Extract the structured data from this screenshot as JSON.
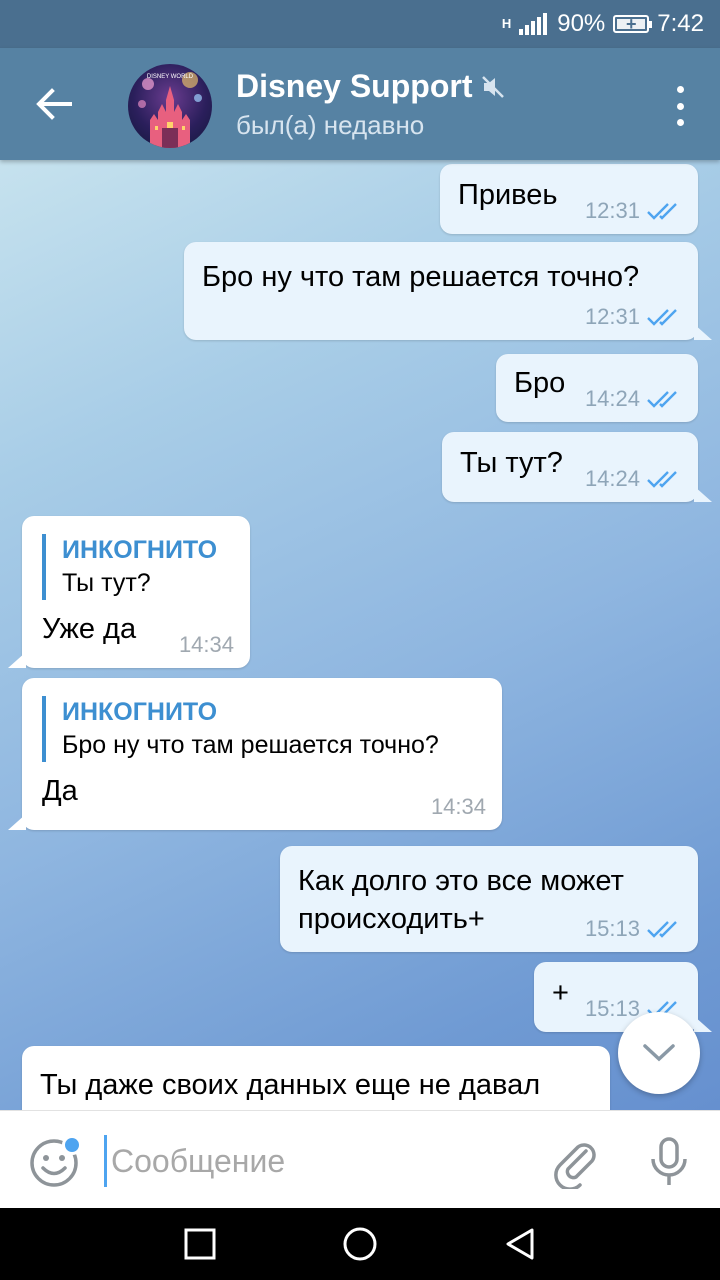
{
  "status_bar": {
    "network": "H",
    "battery": "90%",
    "time": "7:42"
  },
  "header": {
    "title": "Disney Support",
    "subtitle": "был(а) недавно",
    "avatar_text": "DISNEY WORLD",
    "icons": [
      "back-arrow-icon",
      "muted-icon",
      "more-vert-icon"
    ]
  },
  "messages": [
    {
      "dir": "out",
      "text": "Привеь",
      "time": "12:31",
      "read": true
    },
    {
      "dir": "out",
      "text": "Бро ну что там решается точно?",
      "time": "12:31",
      "read": true
    },
    {
      "dir": "out",
      "text": "Бро",
      "time": "14:24",
      "read": true
    },
    {
      "dir": "out",
      "text": "Ты тут?",
      "time": "14:24",
      "read": true
    },
    {
      "dir": "in",
      "reply_name": "ИНКОГНИТО",
      "reply_text": "Ты тут?",
      "text": "Уже да",
      "time": "14:34"
    },
    {
      "dir": "in",
      "reply_name": "ИНКОГНИТО",
      "reply_text": "Бро ну что там решается точно?",
      "text": "Да",
      "time": "14:34"
    },
    {
      "dir": "out",
      "text_line1": "Как долго это все может",
      "text_line2": "происходить+",
      "time": "15:13",
      "read": true
    },
    {
      "dir": "out",
      "text": "+",
      "time": "15:13",
      "read": true
    },
    {
      "dir": "in",
      "text": "Ты даже своих данных еще не давал"
    }
  ],
  "input": {
    "placeholder": "Сообщение",
    "value": ""
  },
  "colors": {
    "header": "#5682a3",
    "status_bar": "#4a6f8f",
    "accent": "#3d8fd1",
    "out_bubble": "#e9f4fd",
    "in_bubble": "#ffffff",
    "ticks": "#4ea4f0"
  }
}
